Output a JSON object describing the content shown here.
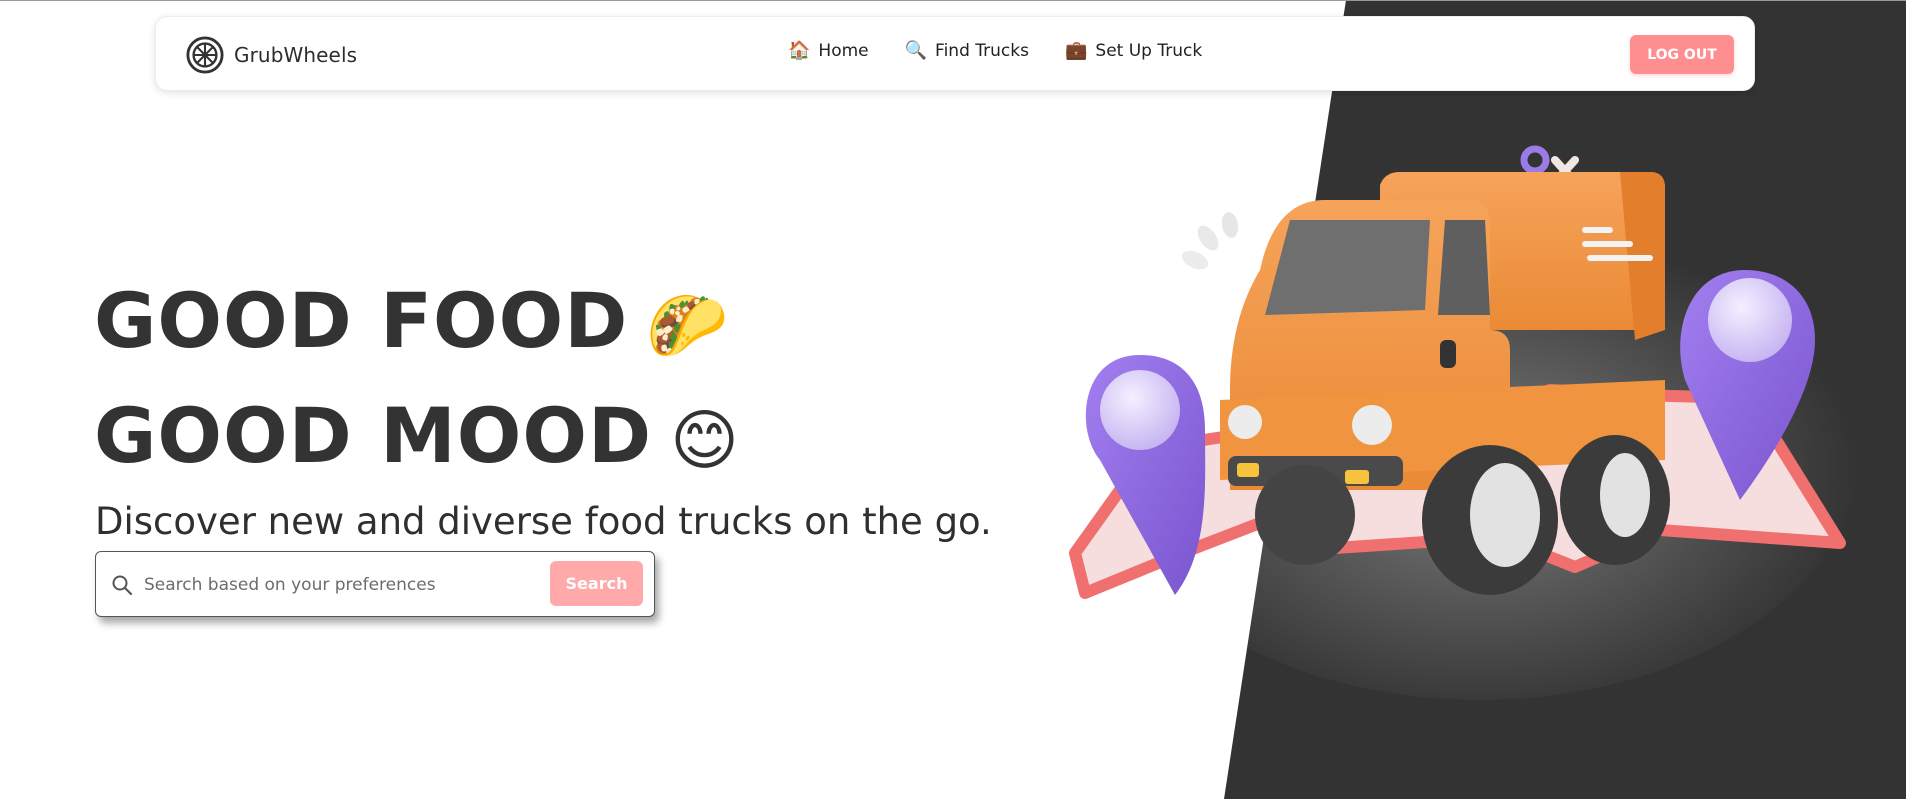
{
  "brand": {
    "name": "GrubWheels",
    "icon": "wheel-icon"
  },
  "nav": {
    "links": [
      {
        "emoji": "🏠",
        "label": "Home",
        "icon": "house-icon"
      },
      {
        "emoji": "🔍",
        "label": "Find Trucks",
        "icon": "magnifier-icon"
      },
      {
        "emoji": "💼",
        "label": "Set Up Truck",
        "icon": "briefcase-icon"
      }
    ],
    "logout_label": "LOG OUT"
  },
  "hero": {
    "line1": "GOOD FOOD",
    "line1_emoji": "🌮",
    "line2": "GOOD MOOD",
    "line2_emoji": "😊",
    "subtitle": "Discover new and diverse food trucks on the go."
  },
  "search": {
    "placeholder": "Search based on your preferences",
    "value": "",
    "button_label": "Search"
  },
  "colors": {
    "accent": "#ff8e91",
    "search_button": "#ffa9aa",
    "dark_panel": "#333333",
    "truck_orange": "#f4913c",
    "pin_purple": "#8f6ad8",
    "map_pink": "#f07070"
  }
}
